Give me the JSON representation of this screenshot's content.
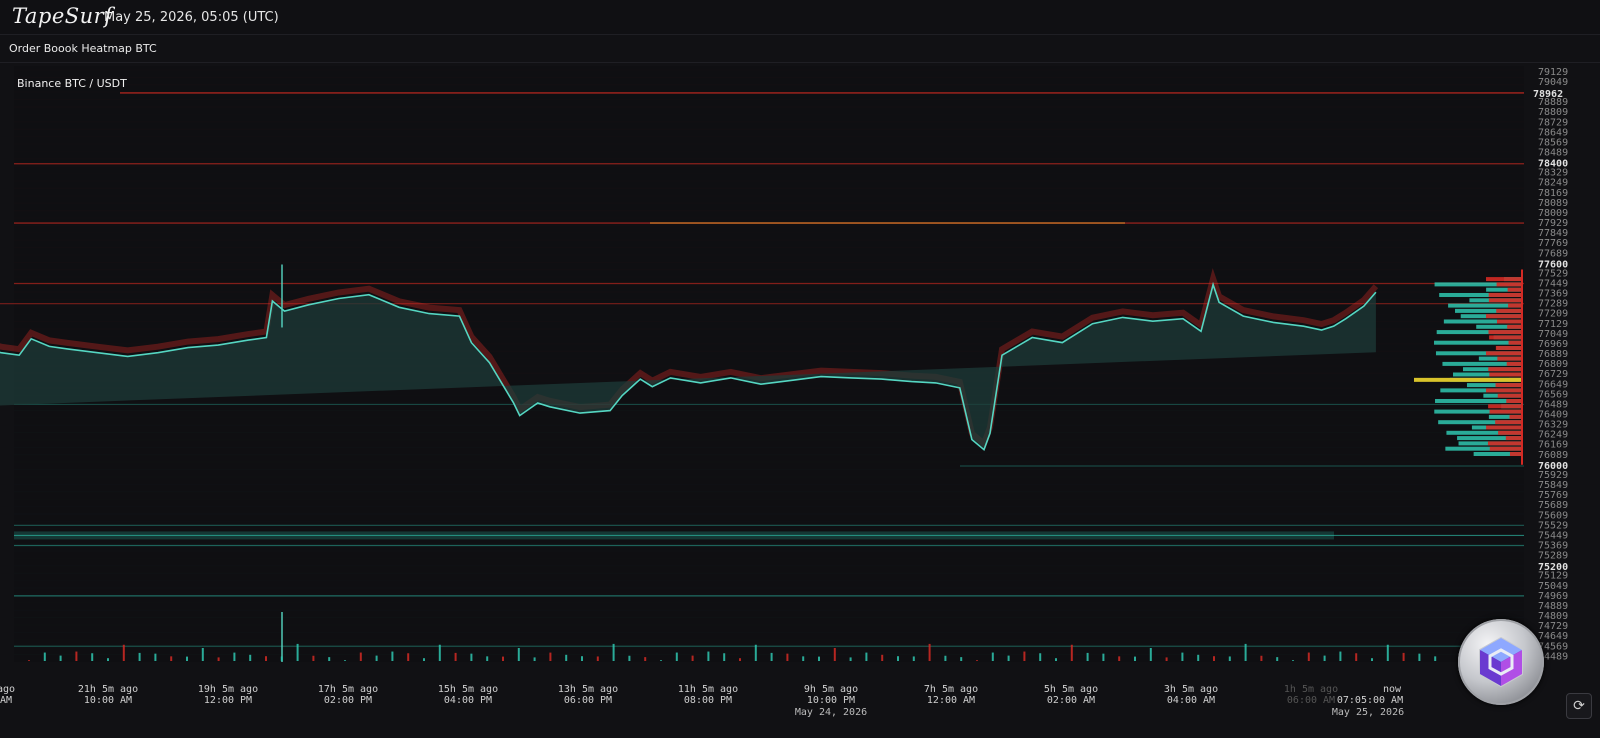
{
  "header": {
    "logo": "TapeSurf",
    "datetime": "May 25, 2026, 05:05 (UTC)"
  },
  "page": {
    "title": "Order Boook Heatmap BTC"
  },
  "chart_data": {
    "type": "heatmap",
    "pair_label": "Binance BTC / USDT",
    "y_ticks": [
      79129,
      79049,
      78889,
      78809,
      78729,
      78649,
      78569,
      78489,
      78400,
      78329,
      78249,
      78169,
      78089,
      78009,
      77929,
      77849,
      77769,
      77689,
      77600,
      77529,
      77449,
      77369,
      77289,
      77209,
      77129,
      77049,
      76969,
      76889,
      76809,
      76729,
      76649,
      76569,
      76489,
      76409,
      76329,
      76249,
      76169,
      76089,
      76000,
      75929,
      75849,
      75769,
      75689,
      75609,
      75529,
      75449,
      75369,
      75289,
      75200,
      75129,
      75049,
      74969,
      74889,
      74809,
      74729,
      74649,
      74569,
      74489
    ],
    "y_bold_ticks": [
      78400,
      77600,
      76800,
      76000,
      75200
    ],
    "current_price_label": "78962",
    "current_price": 78962,
    "ylim": [
      74460,
      79160
    ],
    "x_labels": [
      {
        "top": "ago",
        "bottom": "AM",
        "sub": ""
      },
      {
        "top": "21h 5m ago",
        "bottom": "10:00 AM",
        "sub": ""
      },
      {
        "top": "19h 5m ago",
        "bottom": "12:00 PM",
        "sub": ""
      },
      {
        "top": "17h 5m ago",
        "bottom": "02:00 PM",
        "sub": ""
      },
      {
        "top": "15h 5m ago",
        "bottom": "04:00 PM",
        "sub": ""
      },
      {
        "top": "13h 5m ago",
        "bottom": "06:00 PM",
        "sub": ""
      },
      {
        "top": "11h 5m ago",
        "bottom": "08:00 PM",
        "sub": ""
      },
      {
        "top": "9h 5m ago",
        "bottom": "10:00 PM",
        "sub": "May 24, 2026"
      },
      {
        "top": "7h 5m ago",
        "bottom": "12:00 AM",
        "sub": ""
      },
      {
        "top": "5h 5m ago",
        "bottom": "02:00 AM",
        "sub": ""
      },
      {
        "top": "3h 5m ago",
        "bottom": "04:00 AM",
        "sub": ""
      },
      {
        "top": "1h 5m ago",
        "bottom": "06:00 AM",
        "sub": ""
      },
      {
        "top": "now",
        "bottom": "07:05:00 AM",
        "sub": "May 25, 2026"
      }
    ],
    "price_series": {
      "x_hours_ago": [
        23.5,
        23.1,
        22.8,
        22.6,
        22.3,
        22.0,
        21.5,
        21.0,
        20.5,
        20.0,
        19.5,
        19.0,
        18.7,
        18.6,
        18.4,
        18.0,
        17.5,
        17.0,
        16.5,
        16.0,
        15.5,
        15.3,
        15.0,
        14.6,
        14.5,
        14.2,
        14.0,
        13.5,
        13.0,
        12.8,
        12.5,
        12.3,
        12.0,
        11.5,
        11.0,
        10.5,
        10.0,
        9.5,
        9.0,
        8.5,
        8.0,
        7.6,
        7.2,
        7.0,
        6.8,
        6.7,
        6.5,
        6.0,
        5.5,
        5.0,
        4.5,
        4.0,
        3.5,
        3.2,
        3.0,
        2.9,
        2.5,
        2.0,
        1.5,
        1.2,
        1.0,
        0.8,
        0.5,
        0.3
      ],
      "price": [
        76950,
        76900,
        76880,
        77010,
        76950,
        76930,
        76900,
        76870,
        76900,
        76940,
        76960,
        77000,
        77020,
        77310,
        77230,
        77280,
        77330,
        77360,
        77260,
        77210,
        77190,
        76980,
        76820,
        76500,
        76400,
        76500,
        76470,
        76420,
        76440,
        76560,
        76690,
        76630,
        76700,
        76660,
        76700,
        76650,
        76680,
        76710,
        76700,
        76690,
        76670,
        76660,
        76620,
        76210,
        76130,
        76260,
        76880,
        77020,
        76980,
        77130,
        77180,
        77150,
        77170,
        77070,
        77440,
        77300,
        77190,
        77140,
        77110,
        77080,
        77110,
        77170,
        77270,
        77380
      ]
    },
    "bar_top_heights": [
      2,
      13,
      6,
      18,
      10,
      7,
      25,
      9,
      14,
      6,
      11,
      20,
      4,
      16,
      8,
      12,
      7,
      19,
      10,
      5
    ]
  },
  "colors": {
    "bid": "#2fc7b0",
    "ask": "#d42a24",
    "highlight": "#d9c32b",
    "line": "#e02c22"
  },
  "controls": {
    "refresh_icon": "⟳"
  }
}
